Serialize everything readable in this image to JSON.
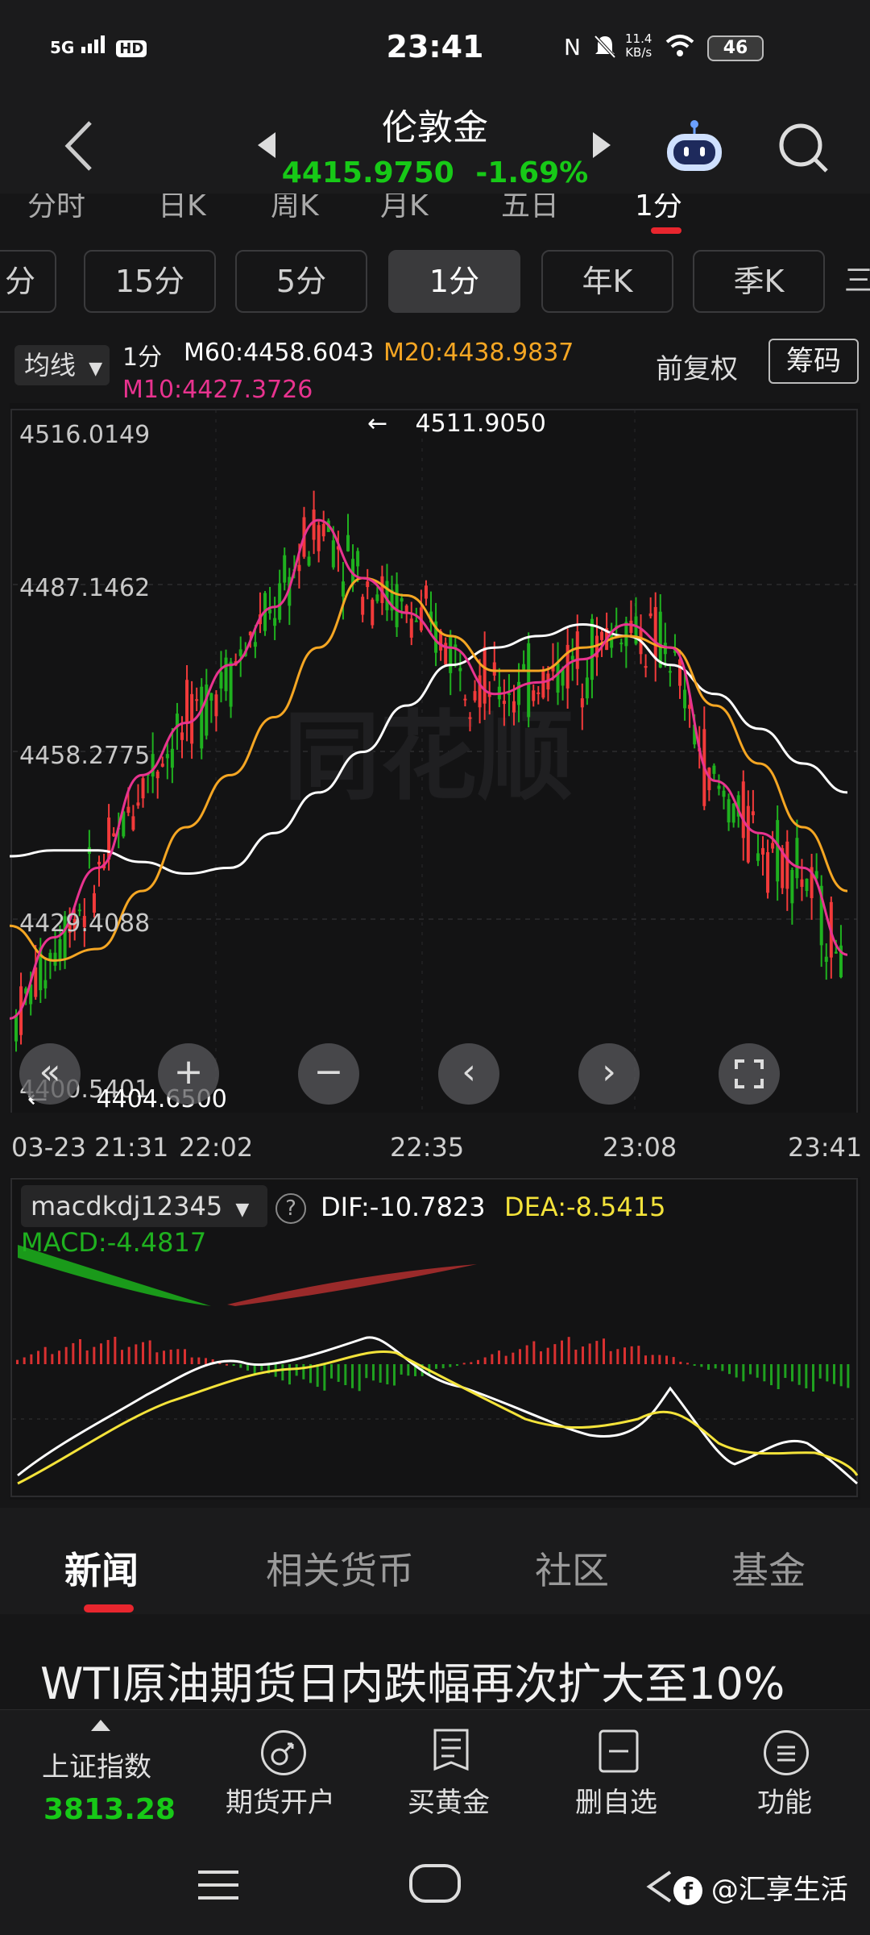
{
  "status": {
    "network": "5G",
    "hd": "HD",
    "time": "23:41",
    "speed_value": "11.4",
    "speed_unit": "KB/s",
    "battery": "46"
  },
  "header": {
    "title": "伦敦金",
    "price": "4415.9750",
    "change": "-1.69%"
  },
  "partial_tabs": [
    "分时",
    "日K",
    "周K",
    "月K",
    "五日",
    "1分"
  ],
  "periods": [
    {
      "label": "分",
      "active": false
    },
    {
      "label": "15分",
      "active": false
    },
    {
      "label": "5分",
      "active": false
    },
    {
      "label": "1分",
      "active": true
    },
    {
      "label": "年K",
      "active": false
    },
    {
      "label": "季K",
      "active": false
    }
  ],
  "indicators": {
    "ma_select": "均线",
    "period": "1分",
    "m60": "M60:4458.6043",
    "m20": "M20:4438.9837",
    "m10": "M10:4427.3726",
    "adjust": "前复权",
    "chips": "筹码",
    "colors": {
      "m60": "#ffffff",
      "m20": "#f5a623",
      "m10": "#e8338f"
    }
  },
  "chart": {
    "y_labels": [
      "4516.0149",
      "4487.1462",
      "4458.2775",
      "4429.4088",
      "4400.5401"
    ],
    "high_marker": "4511.9050",
    "low_marker": "4404.6500",
    "x_labels": [
      "03-23 21:31",
      "22:02",
      "22:35",
      "23:08",
      "23:41"
    ],
    "watermark": "同花顺",
    "up_color": "#f23a3a",
    "down_color": "#1fb11f"
  },
  "chart_data": {
    "type": "candlestick",
    "ylim": [
      4400.5401,
      4516.0149
    ],
    "m60": [
      4442,
      4443,
      4443,
      4441,
      4439,
      4440,
      4446,
      4453,
      4460,
      4468,
      4475,
      4478,
      4480,
      4482,
      4480,
      4475,
      4470,
      4464,
      4458,
      4453
    ],
    "m20": [
      4430,
      4424,
      4426,
      4436,
      4447,
      4456,
      4466,
      4478,
      4490,
      4487,
      4480,
      4474,
      4474,
      4478,
      4480,
      4478,
      4468,
      4458,
      4447,
      4436
    ],
    "m10": [
      4414,
      4428,
      4440,
      4456,
      4465,
      4475,
      4485,
      4500,
      4490,
      4484,
      4478,
      4470,
      4472,
      4476,
      4482,
      4478,
      4455,
      4446,
      4440,
      4425
    ]
  },
  "macd": {
    "select": "macdkdj12345",
    "help": "?",
    "dif": "DIF:-10.7823",
    "dea": "DEA:-8.5415",
    "macd": "MACD:-4.4817",
    "colors": {
      "dif": "#ffffff",
      "dea": "#f4e33a",
      "macd": "#1fb11f"
    }
  },
  "bottom_tabs": [
    {
      "label": "新闻",
      "active": true
    },
    {
      "label": "相关货币",
      "active": false
    },
    {
      "label": "社区",
      "active": false
    },
    {
      "label": "基金",
      "active": false
    }
  ],
  "news_headline": "WTI原油期货日内跌幅再次扩大至10%",
  "bottom_bar": {
    "index_name": "上证指数",
    "index_value": "3813.28",
    "items": [
      "期货开户",
      "买黄金",
      "删自选",
      "功能"
    ]
  },
  "watermark_text": "@汇享生活"
}
